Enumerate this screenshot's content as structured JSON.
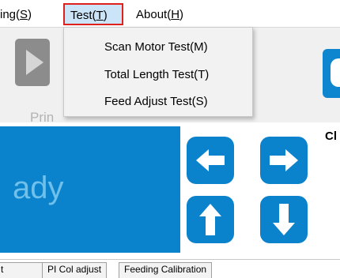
{
  "menubar": {
    "setting_prefix": "ing(",
    "setting_key": "S",
    "setting_suffix": ")",
    "test_prefix": "Test(",
    "test_key": "T",
    "test_suffix": ")",
    "about_prefix": "About(",
    "about_key": "H",
    "about_suffix": ")"
  },
  "dropdown": {
    "items": [
      {
        "label": "Scan Motor Test(M)"
      },
      {
        "label": "Total Length Test(T)"
      },
      {
        "label": "Feed Adjust Test(S)"
      }
    ]
  },
  "toolbar": {
    "print_label": "Prin",
    "right_label": "Cl"
  },
  "status": {
    "text": "ady"
  },
  "arrows": {
    "left_icon": "arrow-left-icon",
    "right_icon": "arrow-right-icon",
    "up_icon": "arrow-up-icon",
    "down_icon": "arrow-down-icon"
  },
  "tabs": [
    "t",
    "PI Col adjust",
    "Feeding Calibration"
  ],
  "colors": {
    "accent_blue": "#0a82cc",
    "menu_highlight": "#cce4f7",
    "highlight_border": "#e0201b",
    "status_text": "#6fc0ea"
  }
}
